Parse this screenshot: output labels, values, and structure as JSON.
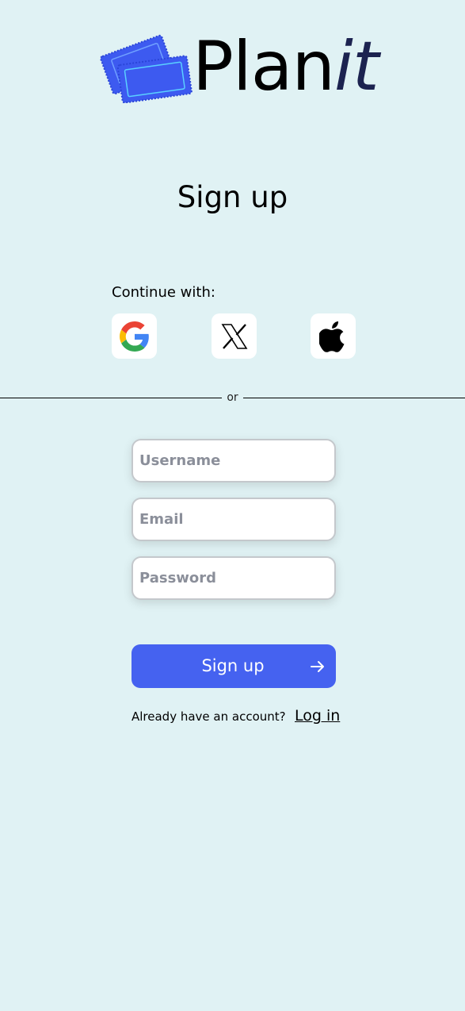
{
  "brand": {
    "name_prefix": "Plan",
    "name_suffix": "it",
    "logo_icon": "ticket-icon",
    "logo_color": "#3d5af0"
  },
  "page": {
    "title": "Sign up"
  },
  "social": {
    "label": "Continue with:",
    "providers": [
      {
        "name": "Google",
        "icon": "google-icon"
      },
      {
        "name": "X",
        "icon": "x-icon"
      },
      {
        "name": "Apple",
        "icon": "apple-icon"
      }
    ]
  },
  "divider": {
    "text": "or"
  },
  "form": {
    "username_placeholder": "Username",
    "email_placeholder": "Email",
    "password_placeholder": "Password",
    "username_value": "",
    "email_value": "",
    "password_value": "",
    "submit_label": "Sign up",
    "submit_icon": "arrow-right-icon",
    "accent_color": "#4562f0"
  },
  "footer": {
    "prompt": "Already have an account?",
    "login_label": "Log in"
  }
}
